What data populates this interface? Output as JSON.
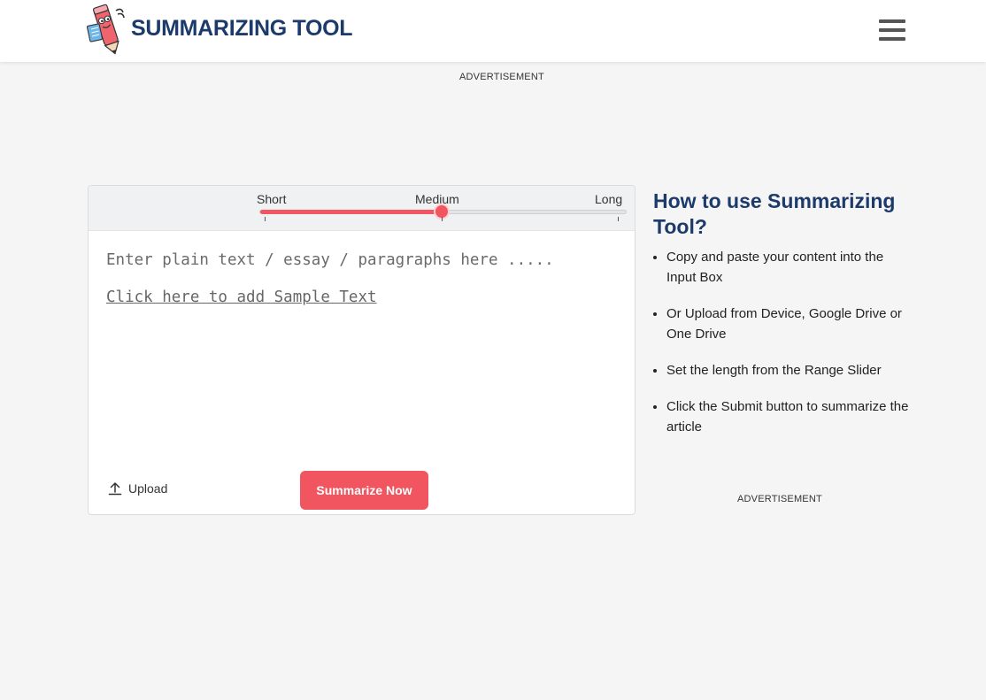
{
  "header": {
    "brand": "SUMMARIZING TOOL",
    "logo_icon": "pencil-mascot-icon",
    "menu_icon": "hamburger-menu-icon"
  },
  "ads": {
    "top_label": "ADVERTISEMENT",
    "side_label": "ADVERTISEMENT"
  },
  "tool": {
    "length_options": [
      "Short",
      "Medium",
      "Long"
    ],
    "selected_length": "Medium",
    "slider_level_fraction": 0.5,
    "input_placeholder": "Enter plain text / essay / paragraphs here .....",
    "input_value": "",
    "sample_link": "Click here to add Sample Text",
    "upload_label": "Upload",
    "upload_icon": "upload-arrow-icon",
    "submit_label": "Summarize Now"
  },
  "howto": {
    "title": "How to use Summarizing Tool?",
    "steps": [
      "Copy and paste your content into the Input Box",
      "Or Upload from Device, Google Drive or One Drive",
      "Set the length from the Range Slider",
      "Click the Submit button to summarize the article"
    ]
  },
  "colors": {
    "accent": "#f05560",
    "brand": "#1c3b6b"
  }
}
